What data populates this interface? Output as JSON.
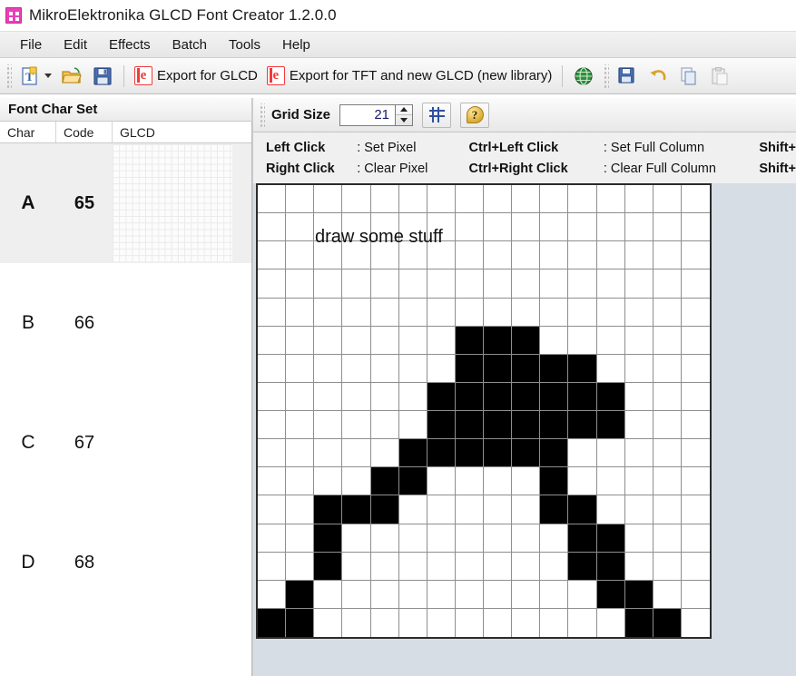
{
  "window": {
    "title": "MikroElektronika GLCD Font Creator 1.2.0.0",
    "icon": "app-icon"
  },
  "menubar": {
    "items": [
      {
        "label": "File"
      },
      {
        "label": "Edit"
      },
      {
        "label": "Effects"
      },
      {
        "label": "Batch"
      },
      {
        "label": "Tools"
      },
      {
        "label": "Help"
      }
    ]
  },
  "toolbar": {
    "new_font_label": "",
    "open_label": "",
    "save_label": "",
    "export_glcd_label": "Export for GLCD",
    "export_tft_label": "Export for TFT and new GLCD (new library)",
    "web_label": "",
    "save_as_label": "",
    "undo_label": "",
    "copy_label": "",
    "paste_label": "",
    "icons": {
      "new": "new-font-icon",
      "open": "open-folder-icon",
      "save": "save-disk-icon",
      "export_glcd": "export-e-icon",
      "export_tft": "export-e-icon",
      "web": "globe-icon",
      "save_as": "save-as-icon",
      "undo": "undo-arrow-icon",
      "copy": "copy-icon",
      "paste": "paste-icon"
    }
  },
  "left_panel": {
    "header": "Font Char Set",
    "columns": [
      "Char",
      "Code",
      "GLCD"
    ],
    "rows": [
      {
        "char": "A",
        "code": "65",
        "selected": true,
        "has_preview": true
      },
      {
        "char": "B",
        "code": "66",
        "selected": false,
        "has_preview": false
      },
      {
        "char": "C",
        "code": "67",
        "selected": false,
        "has_preview": false
      },
      {
        "char": "D",
        "code": "68",
        "selected": false,
        "has_preview": false
      }
    ]
  },
  "gridsize_bar": {
    "label": "Grid Size",
    "value": "21",
    "placeholder": "21",
    "grid_toggle_icon": "grid-icon",
    "help_icon": "help-question-icon",
    "spinner_up_icon": "spinner-up-icon",
    "spinner_down_icon": "spinner-down-icon"
  },
  "hints": {
    "rows": [
      {
        "k1": "Left Click",
        "v1": ": Set Pixel",
        "k2": "Ctrl+Left Click",
        "v2": ": Set Full Column",
        "k3": "Shift+"
      },
      {
        "k1": "Right Click",
        "v1": ": Clear Pixel",
        "k2": "Ctrl+Right Click",
        "v2": ": Clear Full Column",
        "k3": "Shift+"
      }
    ]
  },
  "canvas": {
    "overlay_text": "draw some stuff",
    "grid": {
      "cols": 16,
      "rows": 16,
      "on_color": "#000000",
      "off_color": "#ffffff",
      "line_color": "#8e8e8e",
      "filled_cells": [
        [
          5,
          7
        ],
        [
          5,
          8
        ],
        [
          5,
          9
        ],
        [
          6,
          7
        ],
        [
          6,
          8
        ],
        [
          6,
          9
        ],
        [
          6,
          10
        ],
        [
          6,
          11
        ],
        [
          7,
          6
        ],
        [
          7,
          7
        ],
        [
          7,
          8
        ],
        [
          7,
          9
        ],
        [
          7,
          10
        ],
        [
          7,
          11
        ],
        [
          7,
          12
        ],
        [
          8,
          6
        ],
        [
          8,
          7
        ],
        [
          8,
          8
        ],
        [
          8,
          9
        ],
        [
          8,
          10
        ],
        [
          8,
          11
        ],
        [
          8,
          12
        ],
        [
          9,
          5
        ],
        [
          9,
          6
        ],
        [
          9,
          7
        ],
        [
          9,
          8
        ],
        [
          9,
          9
        ],
        [
          9,
          10
        ],
        [
          10,
          4
        ],
        [
          10,
          5
        ],
        [
          10,
          10
        ],
        [
          11,
          2
        ],
        [
          11,
          3
        ],
        [
          11,
          4
        ],
        [
          11,
          10
        ],
        [
          11,
          11
        ],
        [
          12,
          2
        ],
        [
          12,
          11
        ],
        [
          12,
          12
        ],
        [
          13,
          2
        ],
        [
          13,
          11
        ],
        [
          13,
          12
        ],
        [
          14,
          1
        ],
        [
          14,
          12
        ],
        [
          14,
          13
        ],
        [
          15,
          0
        ],
        [
          15,
          1
        ],
        [
          15,
          13
        ],
        [
          15,
          14
        ]
      ]
    }
  }
}
